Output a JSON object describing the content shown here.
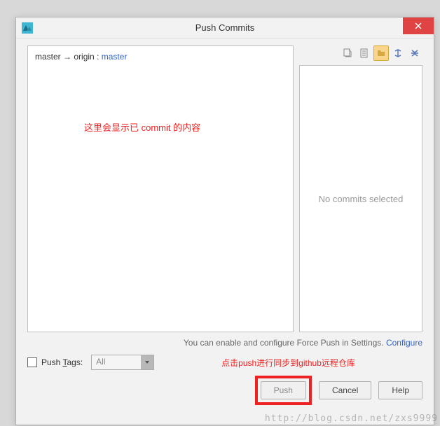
{
  "title": "Push Commits",
  "branch": {
    "local": "master",
    "arrow": "→",
    "remote_name": "origin",
    "colon": ":",
    "remote_branch": "master"
  },
  "annotation1": "这里会显示已 commit 的内容",
  "right_panel_msg": "No commits selected",
  "hint_text": "You can enable and configure Force Push in Settings. ",
  "hint_link": "Configure",
  "push_tags_label_pre": "Push ",
  "push_tags_label_u": "T",
  "push_tags_label_post": "ags:",
  "tags_select": "All",
  "annotation2": "点击push进行同步到github远程仓库",
  "buttons": {
    "push": "Push",
    "cancel": "Cancel",
    "help": "Help"
  },
  "watermark": "http://blog.csdn.net/zxs9999"
}
